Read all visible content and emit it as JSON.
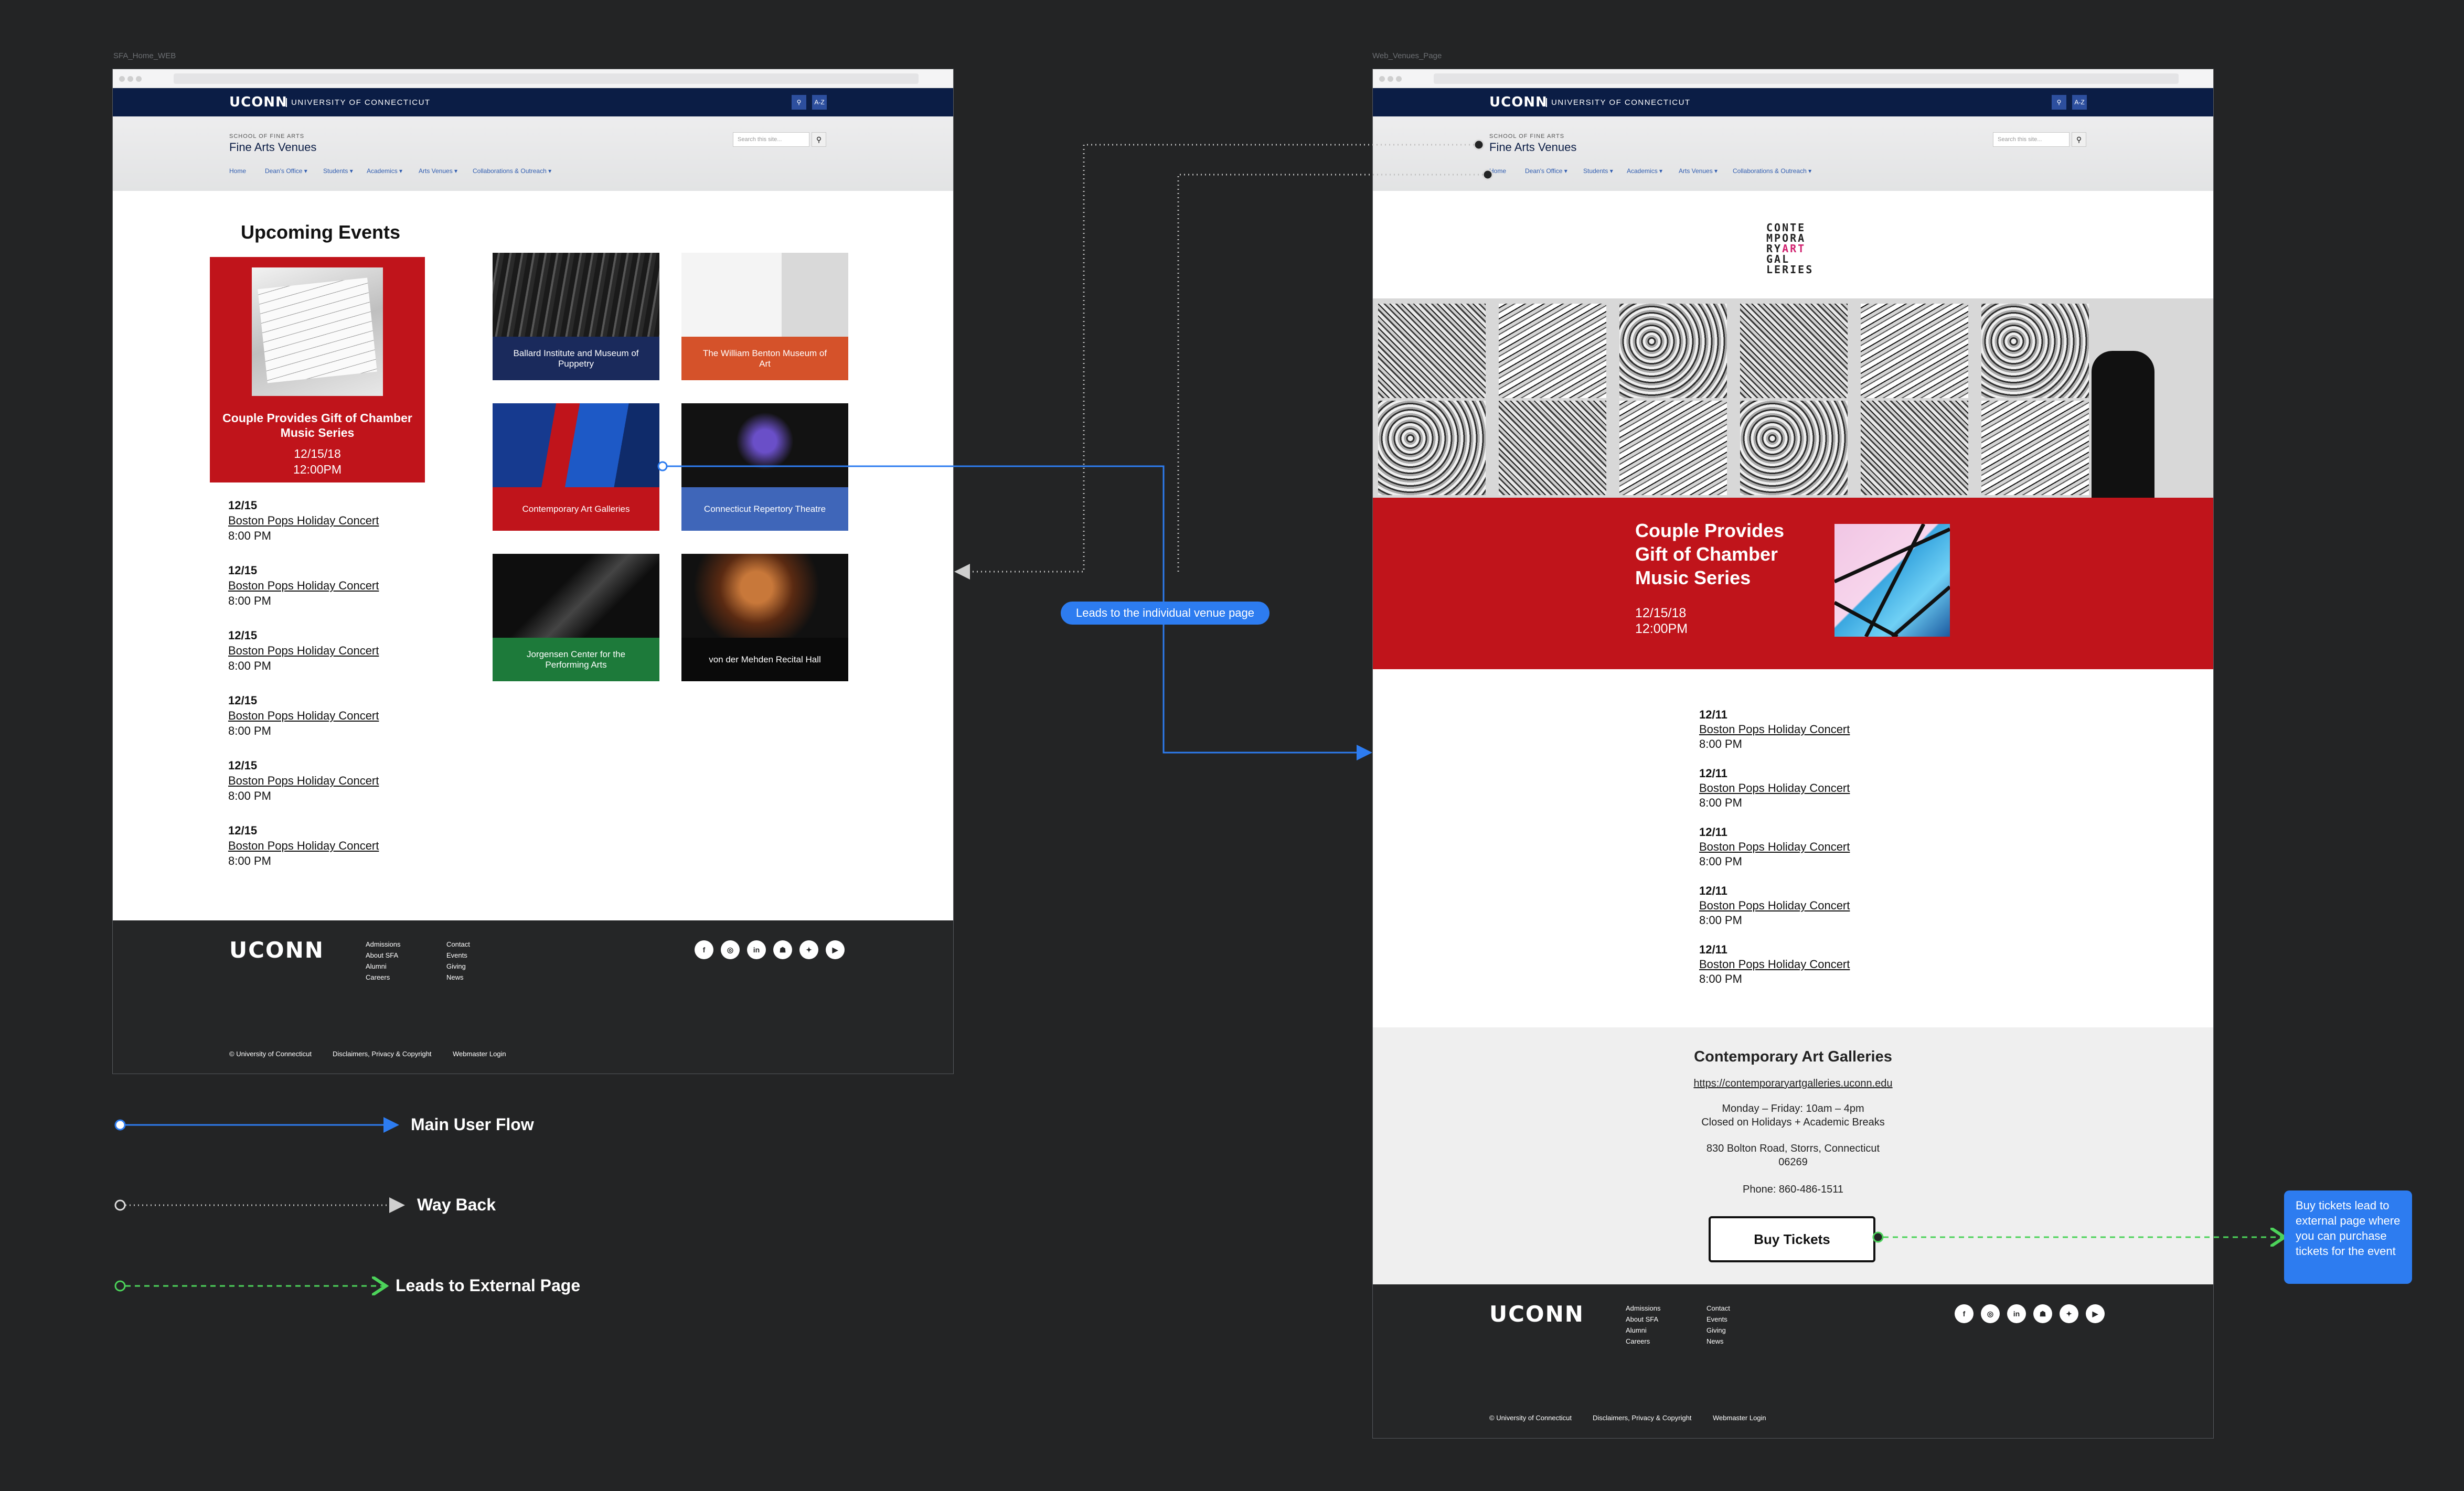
{
  "canvas": {
    "background": "#232425"
  },
  "home_frame": {
    "label": "SFA_Home_WEB",
    "url_bar": "",
    "brand": {
      "logo": "UCONN",
      "university": "UNIVERSITY OF CONNECTICUT",
      "search_icon": "search-icon",
      "az_label": "A-Z"
    },
    "header": {
      "school": "SCHOOL OF FINE ARTS",
      "title": "Fine Arts Venues",
      "search_placeholder": "Search this site...",
      "nav": [
        "Home",
        "Dean's Office ▾",
        "Students ▾",
        "Academics ▾",
        "Arts Venues ▾",
        "Collaborations & Outreach ▾"
      ]
    },
    "upcoming_title": "Upcoming Events",
    "featured": {
      "title": "Couple Provides Gift of Chamber Music Series",
      "date": "12/15/18",
      "time": "12:00PM"
    },
    "events": [
      {
        "date": "12/15",
        "name": "Boston Pops Holiday Concert",
        "time": "8:00 PM"
      },
      {
        "date": "12/15",
        "name": "Boston Pops Holiday Concert",
        "time": "8:00 PM"
      },
      {
        "date": "12/15",
        "name": "Boston Pops Holiday Concert",
        "time": "8:00 PM"
      },
      {
        "date": "12/15",
        "name": "Boston Pops Holiday Concert",
        "time": "8:00 PM"
      },
      {
        "date": "12/15",
        "name": "Boston Pops Holiday Concert",
        "time": "8:00 PM"
      },
      {
        "date": "12/15",
        "name": "Boston Pops Holiday Concert",
        "time": "8:00 PM"
      }
    ],
    "venues": [
      {
        "name": "Ballard Institute and Museum of Puppetry",
        "color": "#1a2a5c"
      },
      {
        "name": "The William Benton Museum of Art",
        "color": "#d5522a"
      },
      {
        "name": "Contemporary Art Galleries",
        "color": "#c0141b"
      },
      {
        "name": "Connecticut Repertory Theatre",
        "color": "#3f66b9"
      },
      {
        "name": "Jorgensen Center for the Performing Arts",
        "color": "#1d7a3a"
      },
      {
        "name": "von der Mehden Recital Hall",
        "color": "#0a0a0a"
      }
    ]
  },
  "venue_frame": {
    "label": "Web_Venues_Page",
    "url_bar": "",
    "gallery_logo": [
      "CONTE",
      "MPORA",
      "RY",
      "ART",
      "GAL",
      "LERIES"
    ],
    "featured": {
      "title_lines": [
        "Couple Provides",
        "Gift of Chamber",
        "Music Series"
      ],
      "date": "12/15/18",
      "time": "12:00PM"
    },
    "events": [
      {
        "date": "12/11",
        "name": "Boston Pops Holiday Concert",
        "time": "8:00 PM"
      },
      {
        "date": "12/11",
        "name": "Boston Pops Holiday Concert",
        "time": "8:00 PM"
      },
      {
        "date": "12/11",
        "name": "Boston Pops Holiday Concert",
        "time": "8:00 PM"
      },
      {
        "date": "12/11",
        "name": "Boston Pops Holiday Concert",
        "time": "8:00 PM"
      },
      {
        "date": "12/11",
        "name": "Boston Pops Holiday Concert",
        "time": "8:00 PM"
      }
    ],
    "info": {
      "name": "Contemporary Art Galleries",
      "url": "https://contemporaryartgalleries.uconn.edu",
      "hours": "Monday – Friday: 10am – 4pm",
      "closed": "Closed on Holidays + Academic Breaks",
      "address_1": "830 Bolton Road, Storrs, Connecticut",
      "address_2": "06269",
      "phone": "Phone: 860-486-1511",
      "buy_label": "Buy Tickets"
    }
  },
  "footer": {
    "logo": "UCONN",
    "col1": [
      "Admissions",
      "About SFA",
      "Alumni",
      "Careers"
    ],
    "col2": [
      "Contact",
      "Events",
      "Giving",
      "News"
    ],
    "social": [
      {
        "icon": "facebook-icon",
        "glyph": "f"
      },
      {
        "icon": "instagram-icon",
        "glyph": "◎"
      },
      {
        "icon": "linkedin-icon",
        "glyph": "in"
      },
      {
        "icon": "snapchat-icon",
        "glyph": "☗"
      },
      {
        "icon": "twitter-icon",
        "glyph": "✦"
      },
      {
        "icon": "youtube-icon",
        "glyph": "▶"
      }
    ],
    "copyright": "© University of Connecticut",
    "disclaimers": "Disclaimers, Privacy & Copyright",
    "webmaster": "Webmaster Login"
  },
  "annotations": {
    "venue_callout": "Leads to the individual venue page",
    "external_callout": "Buy tickets lead to external page where you can purchase tickets for the event",
    "legend": [
      {
        "label": "Main User Flow",
        "color": "#2d7cf0",
        "style": "solid"
      },
      {
        "label": "Way Back",
        "color": "#bfbfbf",
        "style": "dotted"
      },
      {
        "label": "Leads to External Page",
        "color": "#4cd35a",
        "style": "dashed"
      }
    ]
  }
}
